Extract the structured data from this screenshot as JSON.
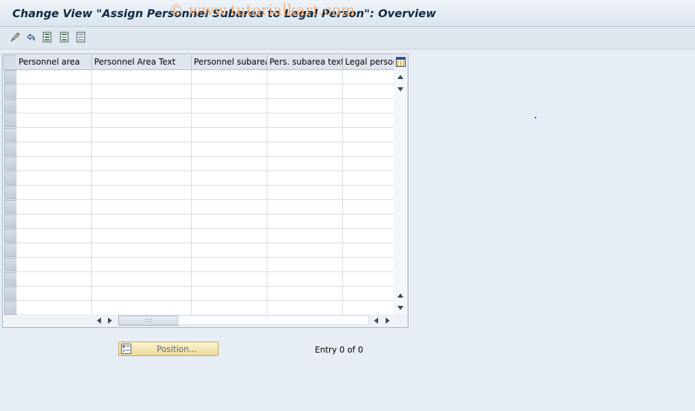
{
  "window": {
    "title": "Change View \"Assign Personnel Subarea to Legal Person\": Overview"
  },
  "watermark": "© www.tutorialkart.com",
  "toolbar": {
    "icons": [
      "edit-pencil-icon",
      "undo-icon",
      "select-all-icon",
      "select-block-icon",
      "deselect-all-icon"
    ]
  },
  "table": {
    "columns": [
      {
        "label": "Personnel area"
      },
      {
        "label": "Personnel Area Text"
      },
      {
        "label": "Personnel subarea"
      },
      {
        "label": "Pers. subarea text"
      },
      {
        "label": "Legal person"
      }
    ],
    "visible_rows": 17,
    "rows": []
  },
  "footer": {
    "position_button": "Position...",
    "entry_info": "Entry 0 of 0"
  },
  "colors": {
    "background": "#e7edf4",
    "title_text": "#102a43",
    "position_button": "#f3e6b3"
  }
}
